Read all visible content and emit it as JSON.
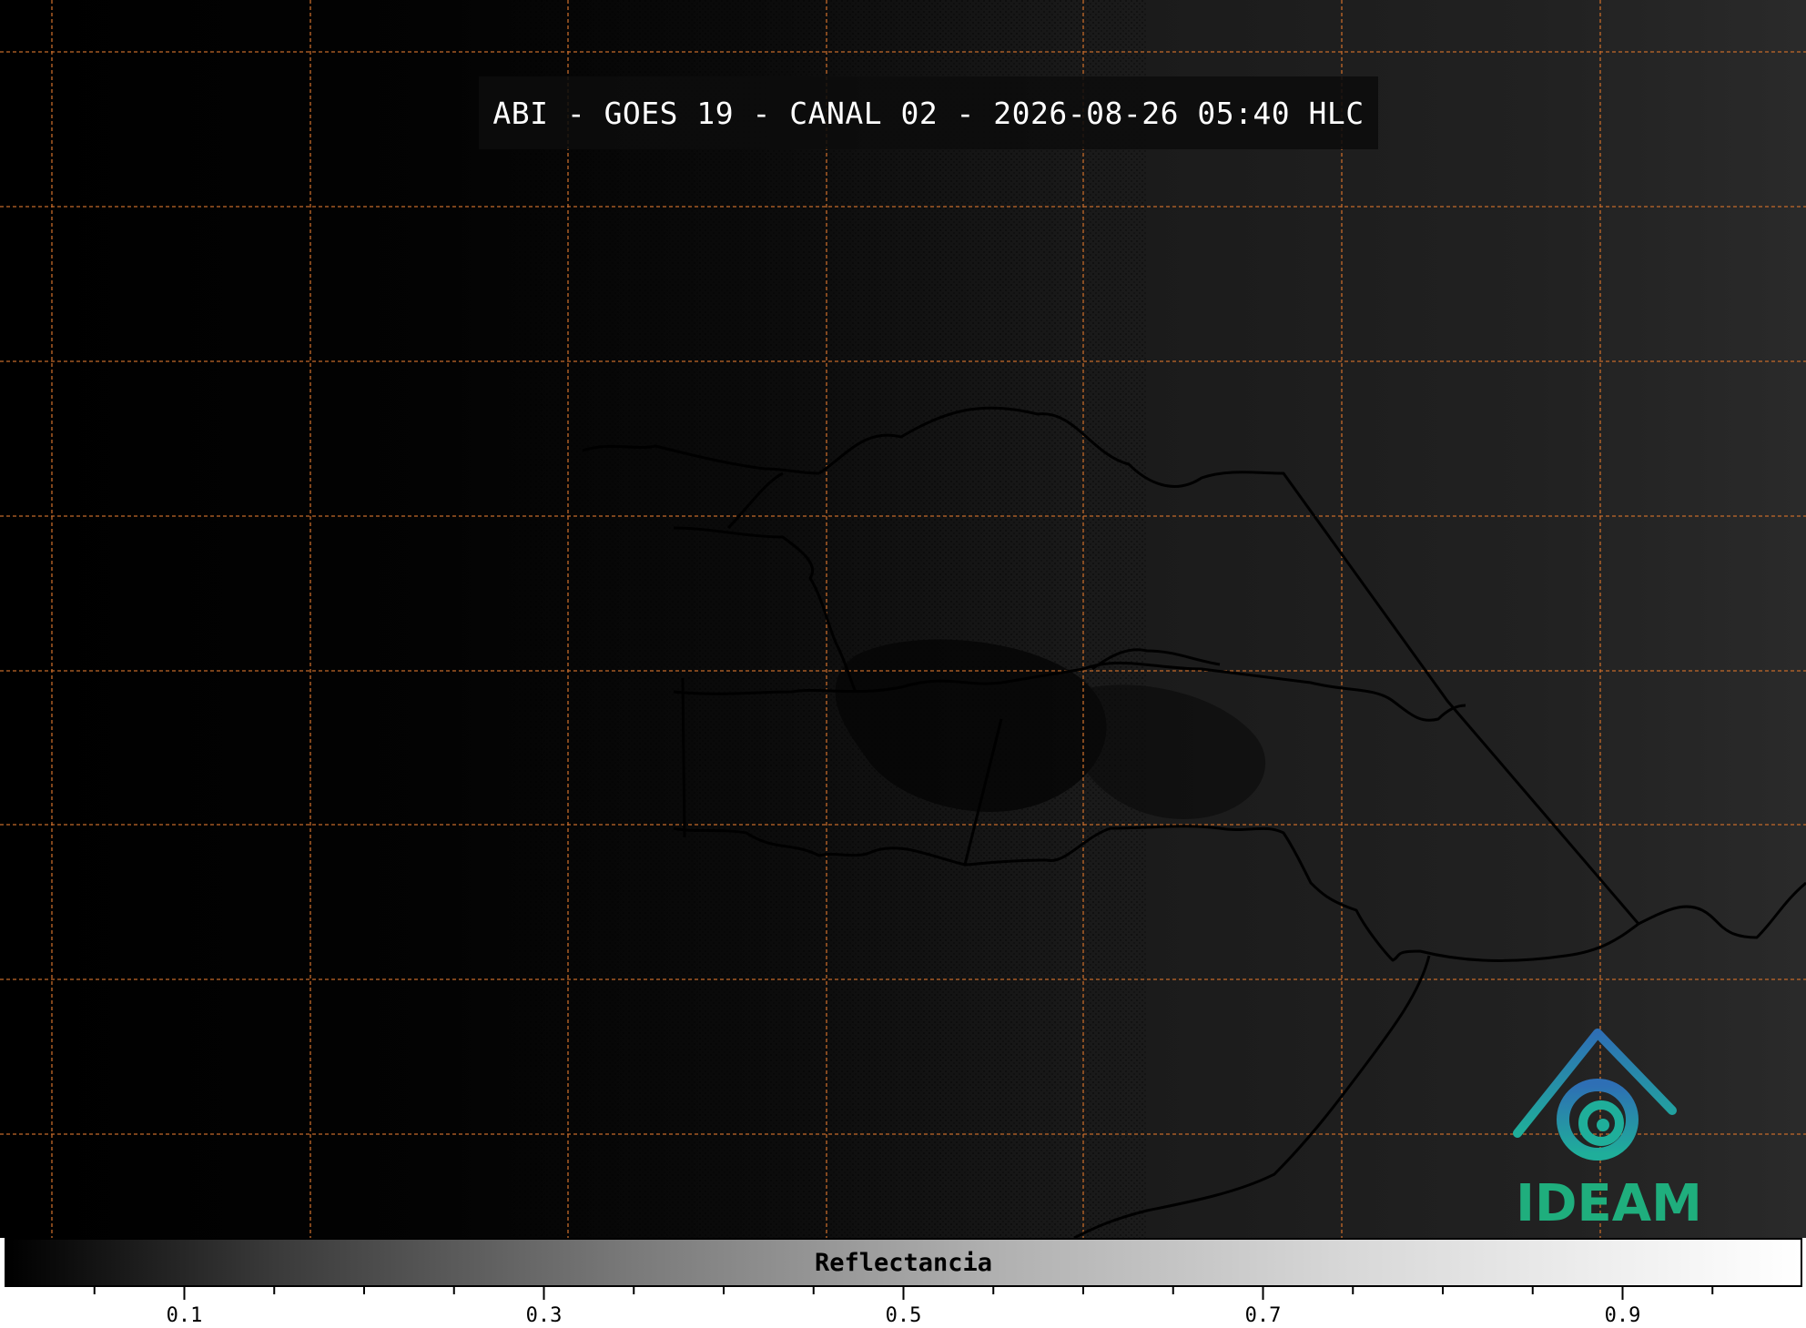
{
  "map": {
    "title": "ABI - GOES 19 - CANAL 02 - 2026-08-26 05:40 HLC",
    "gridline_color": "#c46a2a",
    "boundary_color": "#000000",
    "background_tone": "#0f0f0f"
  },
  "logo": {
    "text": "IDEAM",
    "text_color": "#1fae7d",
    "accent_blue": "#2e6fb5",
    "accent_teal": "#1fae9a"
  },
  "colorbar": {
    "label": "Reflectancia",
    "min": 0.0,
    "max": 1.0,
    "tick_labels": [
      "0.1",
      "0.3",
      "0.5",
      "0.7",
      "0.9"
    ],
    "tick_values": [
      0.1,
      0.3,
      0.5,
      0.7,
      0.9
    ]
  }
}
